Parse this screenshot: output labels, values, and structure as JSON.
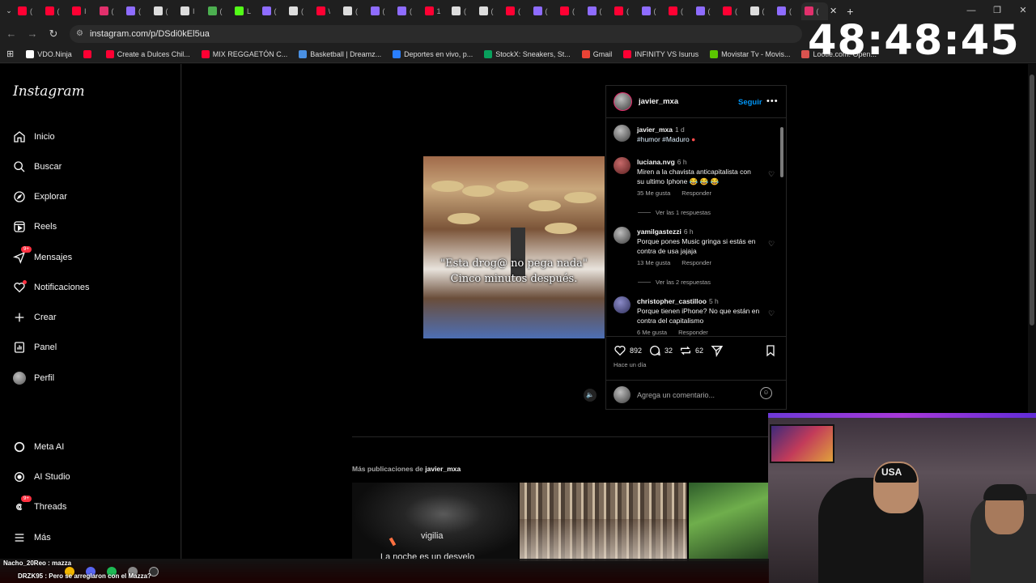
{
  "browser": {
    "tabs": [
      {
        "color": "#ff0033",
        "label": "("
      },
      {
        "color": "#ff0033",
        "label": "("
      },
      {
        "color": "#ff0033",
        "label": "I"
      },
      {
        "color": "#e1306c",
        "label": "("
      },
      {
        "color": "#8e6cff",
        "label": "("
      },
      {
        "color": "#dddddd",
        "label": "("
      },
      {
        "color": "#dddddd",
        "label": "I"
      },
      {
        "color": "#4caf50",
        "label": "("
      },
      {
        "color": "#53fc18",
        "label": "L"
      },
      {
        "color": "#8e6cff",
        "label": "("
      },
      {
        "color": "#dddddd",
        "label": "("
      },
      {
        "color": "#ff0033",
        "label": "\\"
      },
      {
        "color": "#dddddd",
        "label": "("
      },
      {
        "color": "#8e6cff",
        "label": "("
      },
      {
        "color": "#8e6cff",
        "label": "("
      },
      {
        "color": "#ff0033",
        "label": "1"
      },
      {
        "color": "#dddddd",
        "label": "("
      },
      {
        "color": "#dddddd",
        "label": "("
      },
      {
        "color": "#ff0033",
        "label": "("
      },
      {
        "color": "#8e6cff",
        "label": "("
      },
      {
        "color": "#ff0033",
        "label": "("
      },
      {
        "color": "#8e6cff",
        "label": "("
      },
      {
        "color": "#ff0033",
        "label": "("
      },
      {
        "color": "#8e6cff",
        "label": "("
      },
      {
        "color": "#ff0033",
        "label": "("
      },
      {
        "color": "#8e6cff",
        "label": "("
      },
      {
        "color": "#ff0033",
        "label": "("
      },
      {
        "color": "#dddddd",
        "label": "("
      },
      {
        "color": "#8e6cff",
        "label": "("
      },
      {
        "color": "#e1306c",
        "label": "("
      }
    ],
    "url": "instagram.com/p/DSdi0kEl5ua",
    "bookmarks": [
      {
        "label": "VDO.Ninja",
        "color": "#ffffff"
      },
      {
        "label": "",
        "color": "#ff0033"
      },
      {
        "label": "Create a Dulces Chil...",
        "color": "#ff0033"
      },
      {
        "label": "MIX REGGAETÓN C...",
        "color": "#ff0033"
      },
      {
        "label": "Basketball | Dreamz...",
        "color": "#4a90e2"
      },
      {
        "label": "Deportes en vivo, p...",
        "color": "#2a7fff"
      },
      {
        "label": "StockX: Sneakers, St...",
        "color": "#08a05c"
      },
      {
        "label": "Gmail",
        "color": "#ea4335"
      },
      {
        "label": "INFINITY VS Isurus",
        "color": "#ff0033"
      },
      {
        "label": "Movistar Tv - Movis...",
        "color": "#5bc500"
      },
      {
        "label": "Lootie.com: Open...",
        "color": "#d9534f"
      }
    ]
  },
  "timer": "48:48:45",
  "sidebar": {
    "logo": "Instagram",
    "items": [
      {
        "label": "Inicio"
      },
      {
        "label": "Buscar"
      },
      {
        "label": "Explorar"
      },
      {
        "label": "Reels"
      },
      {
        "label": "Mensajes",
        "badge": "9+"
      },
      {
        "label": "Notificaciones"
      },
      {
        "label": "Crear"
      },
      {
        "label": "Panel"
      },
      {
        "label": "Perfil"
      },
      {
        "label": "Meta AI"
      },
      {
        "label": "AI Studio"
      },
      {
        "label": "Threads",
        "badge": "9+"
      },
      {
        "label": "Más"
      }
    ]
  },
  "post": {
    "username": "javier_mxa",
    "follow": "Seguir",
    "caption_overlay": "\"Esta drog@ no pega nada\" Cinco minutos después.",
    "owner_comment": {
      "user": "javier_mxa",
      "time": "1 d",
      "tags": "#humor #Maduro"
    },
    "comments": [
      {
        "user": "luciana.nvg",
        "time": "6 h",
        "text": "Miren a la chavista anticapitalista con su ultimo Iphone 😂 😂 😂",
        "likes": "35 Me gusta",
        "reply": "Responder",
        "replies": "Ver las 1 respuestas"
      },
      {
        "user": "yamilgastezzi",
        "time": "6 h",
        "text": "Porque pones Music gringa si estás en contra de usa jajaja",
        "likes": "13 Me gusta",
        "reply": "Responder",
        "replies": "Ver las 2 respuestas"
      },
      {
        "user": "christopher_castilloo",
        "time": "5 h",
        "text": "Porque tienen iPhone? No que están en contra del capitalismo",
        "likes": "6 Me gusta",
        "reply": "Responder",
        "replies": ""
      }
    ],
    "likes": "892",
    "comments_count": "32",
    "reposts": "62",
    "posted_ago": "Hace un día",
    "comment_placeholder": "Agrega un comentario..."
  },
  "more_posts": {
    "prefix": "Más publicaciones de",
    "user": "javier_mxa",
    "thumb1_line1": "vigilia",
    "thumb1_line2": "La noche es un desvelo"
  },
  "chat": {
    "line1": "Nacho_20Reo : mazza",
    "line2": "DRZK95 : Pero se arreglaron con el Mazza?"
  }
}
